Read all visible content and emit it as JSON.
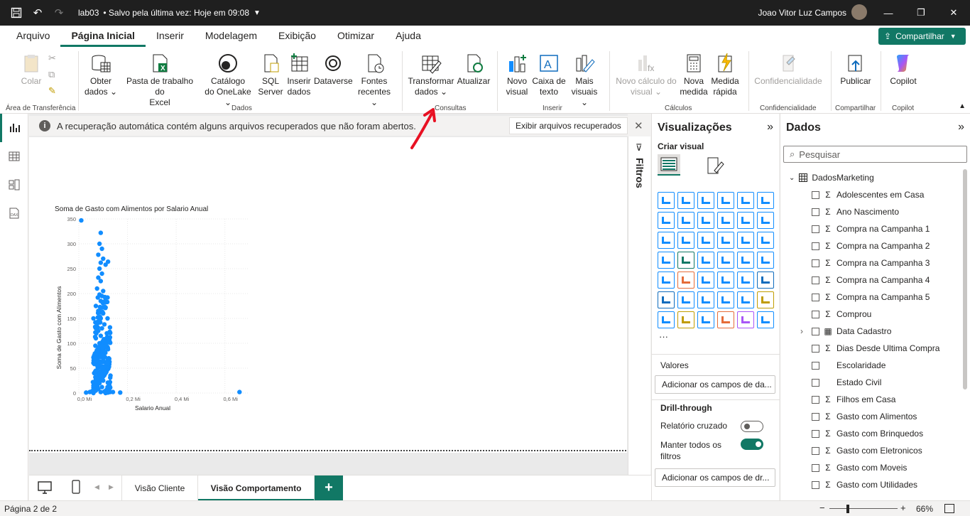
{
  "titlebar": {
    "file_name": "lab03",
    "saved_status": "• Salvo pela última vez: Hoje em 09:08",
    "user_name": "Joao Vitor Luz Campos"
  },
  "menu": {
    "items": [
      "Arquivo",
      "Página Inicial",
      "Inserir",
      "Modelagem",
      "Exibição",
      "Otimizar",
      "Ajuda"
    ],
    "active": "Página Inicial",
    "share_label": "Compartilhar"
  },
  "ribbon": {
    "colar": "Colar",
    "area_transferencia": "Área de Transferência",
    "obter_dados": [
      "Obter",
      "dados ⌄"
    ],
    "pasta_excel": [
      "Pasta de trabalho do",
      "Excel"
    ],
    "catalogo": [
      "Catálogo",
      "do OneLake ⌄"
    ],
    "sql": [
      "SQL",
      "Server"
    ],
    "inserir_dados": [
      "Inserir",
      "dados"
    ],
    "dataverse": "Dataverse",
    "fontes": [
      "Fontes",
      "recentes ⌄"
    ],
    "dados_label": "Dados",
    "transformar": [
      "Transformar",
      "dados ⌄"
    ],
    "atualizar": "Atualizar",
    "consultas_label": "Consultas",
    "novo_visual": [
      "Novo",
      "visual"
    ],
    "caixa_texto": [
      "Caixa de",
      "texto"
    ],
    "mais_visuais": [
      "Mais",
      "visuais ⌄"
    ],
    "inserir_label": "Inserir",
    "novo_calculo": [
      "Novo cálculo do",
      "visual ⌄"
    ],
    "nova_medida": [
      "Nova",
      "medida"
    ],
    "medida_rapida": [
      "Medida",
      "rápida"
    ],
    "calculos_label": "Cálculos",
    "confidencialidade": "Confidencialidade",
    "confidencialidade_label": "Confidencialidade",
    "publicar": "Publicar",
    "compartilhar_label": "Compartilhar",
    "copilot": "Copilot",
    "copilot_label": "Copilot"
  },
  "infobar": {
    "message": "A recuperação automática contém alguns arquivos recuperados que não foram abertos.",
    "button": "Exibir arquivos recuperados"
  },
  "filters_label": "Filtros",
  "chart_data": {
    "type": "scatter",
    "title": "Soma de Gasto com Alimentos por Salario Anual",
    "xlabel": "Salario Anual",
    "ylabel": "Soma de Gasto com Alimentos",
    "xlim": [
      0,
      0.7
    ],
    "ylim": [
      0,
      350
    ],
    "x_ticks": [
      "0,0 Mi",
      "0,2 Mi",
      "0,4 Mi",
      "0,6 Mi"
    ],
    "x_tick_values": [
      0,
      0.2,
      0.4,
      0.6
    ],
    "y_ticks": [
      "0",
      "50",
      "100",
      "150",
      "200",
      "250",
      "300",
      "350"
    ],
    "y_tick_values": [
      0,
      50,
      100,
      150,
      200,
      250,
      300,
      350
    ],
    "color": "#118dff",
    "points": [
      [
        0.01,
        347
      ],
      [
        0.09,
        322
      ],
      [
        0.085,
        300
      ],
      [
        0.095,
        290
      ],
      [
        0.08,
        278
      ],
      [
        0.1,
        270
      ],
      [
        0.09,
        262
      ],
      [
        0.11,
        258
      ],
      [
        0.085,
        250
      ],
      [
        0.095,
        240
      ],
      [
        0.08,
        232
      ],
      [
        0.09,
        225
      ],
      [
        0.12,
        264
      ],
      [
        0.075,
        210
      ],
      [
        0.1,
        205
      ],
      [
        0.085,
        198
      ],
      [
        0.095,
        195
      ],
      [
        0.09,
        185
      ],
      [
        0.07,
        175
      ],
      [
        0.11,
        172
      ],
      [
        0.08,
        165
      ],
      [
        0.1,
        160
      ],
      [
        0.09,
        150
      ],
      [
        0.085,
        145
      ],
      [
        0.075,
        140
      ],
      [
        0.105,
        138
      ],
      [
        0.095,
        130
      ],
      [
        0.08,
        125
      ],
      [
        0.06,
        150
      ],
      [
        0.115,
        120
      ],
      [
        0.09,
        115
      ],
      [
        0.07,
        110
      ],
      [
        0.1,
        105
      ],
      [
        0.085,
        100
      ],
      [
        0.095,
        95
      ],
      [
        0.08,
        90
      ],
      [
        0.075,
        85
      ],
      [
        0.105,
        80
      ],
      [
        0.09,
        75
      ],
      [
        0.065,
        70
      ],
      [
        0.1,
        65
      ],
      [
        0.085,
        60
      ],
      [
        0.08,
        55
      ],
      [
        0.095,
        50
      ],
      [
        0.07,
        45
      ],
      [
        0.11,
        40
      ],
      [
        0.09,
        35
      ],
      [
        0.075,
        30
      ],
      [
        0.1,
        25
      ],
      [
        0.085,
        20
      ],
      [
        0.06,
        15
      ],
      [
        0.095,
        12
      ],
      [
        0.08,
        8
      ],
      [
        0.07,
        5
      ],
      [
        0.105,
        3
      ],
      [
        0.09,
        2
      ],
      [
        0.03,
        1
      ],
      [
        0.045,
        2
      ],
      [
        0.055,
        4
      ],
      [
        0.12,
        6
      ],
      [
        0.14,
        2
      ],
      [
        0.17,
        1
      ],
      [
        0.66,
        2
      ],
      [
        0.125,
        18
      ],
      [
        0.13,
        35
      ],
      [
        0.115,
        60
      ],
      [
        0.12,
        88
      ],
      [
        0.125,
        110
      ],
      [
        0.118,
        150
      ],
      [
        0.108,
        185
      ],
      [
        0.078,
        192
      ],
      [
        0.072,
        120
      ],
      [
        0.068,
        95
      ],
      [
        0.063,
        40
      ],
      [
        0.058,
        22
      ]
    ]
  },
  "visualizations": {
    "header": "Visualizações",
    "criar_visual": "Criar visual",
    "valores_label": "Valores",
    "valores_field": "Adicionar os campos de da...",
    "drill_label": "Drill-through",
    "relatorio_cruzado": "Relatório cruzado",
    "manter_filtros": [
      "Manter todos os",
      "filtros"
    ],
    "drill_field": "Adicionar os campos de dr...",
    "more": "···"
  },
  "dados": {
    "header": "Dados",
    "search_placeholder": "Pesquisar",
    "table_name": "DadosMarketing",
    "fields": [
      {
        "name": "Adolescentes em Casa",
        "sigma": true
      },
      {
        "name": "Ano Nascimento",
        "sigma": true
      },
      {
        "name": "Compra na Campanha 1",
        "sigma": true
      },
      {
        "name": "Compra na Campanha 2",
        "sigma": true
      },
      {
        "name": "Compra na Campanha 3",
        "sigma": true
      },
      {
        "name": "Compra na Campanha 4",
        "sigma": true
      },
      {
        "name": "Compra na Campanha 5",
        "sigma": true
      },
      {
        "name": "Comprou",
        "sigma": true
      },
      {
        "name": "Data Cadastro",
        "sigma": false,
        "table": true,
        "expandable": true
      },
      {
        "name": "Dias Desde Ultima Compra",
        "sigma": true
      },
      {
        "name": "Escolaridade",
        "sigma": false
      },
      {
        "name": "Estado Civil",
        "sigma": false
      },
      {
        "name": "Filhos em Casa",
        "sigma": true
      },
      {
        "name": "Gasto com Alimentos",
        "sigma": true
      },
      {
        "name": "Gasto com Brinquedos",
        "sigma": true
      },
      {
        "name": "Gasto com Eletronicos",
        "sigma": true
      },
      {
        "name": "Gasto com Moveis",
        "sigma": true
      },
      {
        "name": "Gasto com Utilidades",
        "sigma": true
      }
    ]
  },
  "tabs": {
    "items": [
      "Visão Cliente",
      "Visão Comportamento"
    ],
    "active": "Visão Comportamento",
    "add": "+"
  },
  "status": {
    "page": "Página 2 de 2",
    "zoom": "66%"
  }
}
